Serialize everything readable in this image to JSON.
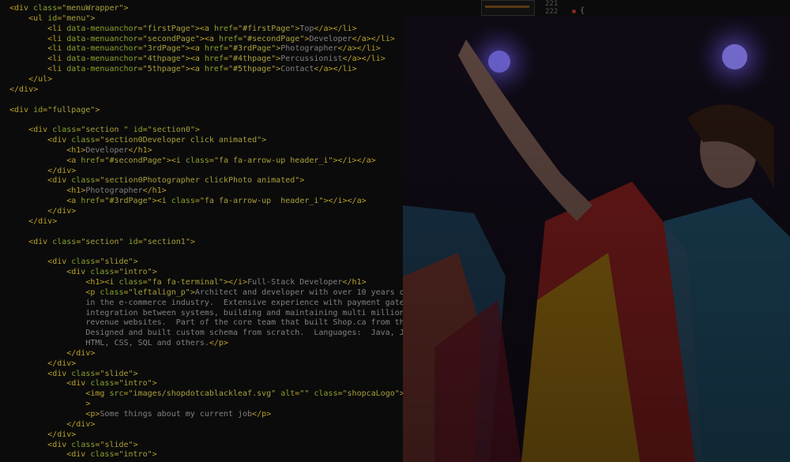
{
  "code_lines": [
    [
      [
        "t",
        "<div "
      ],
      [
        "a",
        "class"
      ],
      [
        "t",
        "="
      ],
      [
        "s",
        "\"menuWrapper\""
      ],
      [
        "t",
        ">"
      ]
    ],
    [
      [
        "x",
        "    "
      ],
      [
        "t",
        "<ul "
      ],
      [
        "a",
        "id"
      ],
      [
        "t",
        "="
      ],
      [
        "s",
        "\"menu\""
      ],
      [
        "t",
        ">"
      ]
    ],
    [
      [
        "x",
        "        "
      ],
      [
        "t",
        "<li "
      ],
      [
        "a",
        "data-menuanchor"
      ],
      [
        "t",
        "="
      ],
      [
        "s",
        "\"firstPage\""
      ],
      [
        "t",
        "><a "
      ],
      [
        "a",
        "href"
      ],
      [
        "t",
        "="
      ],
      [
        "s",
        "\"#firstPage\""
      ],
      [
        "t",
        ">"
      ],
      [
        "x",
        "Top"
      ],
      [
        "t",
        "</a></li>"
      ]
    ],
    [
      [
        "x",
        "        "
      ],
      [
        "t",
        "<li "
      ],
      [
        "a",
        "data-menuanchor"
      ],
      [
        "t",
        "="
      ],
      [
        "s",
        "\"secondPage\""
      ],
      [
        "t",
        "><a "
      ],
      [
        "a",
        "href"
      ],
      [
        "t",
        "="
      ],
      [
        "s",
        "\"#secondPage\""
      ],
      [
        "t",
        ">"
      ],
      [
        "x",
        "Developer"
      ],
      [
        "t",
        "</a></li>"
      ]
    ],
    [
      [
        "x",
        "        "
      ],
      [
        "t",
        "<li "
      ],
      [
        "a",
        "data-menuanchor"
      ],
      [
        "t",
        "="
      ],
      [
        "s",
        "\"3rdPage\""
      ],
      [
        "t",
        "><a "
      ],
      [
        "a",
        "href"
      ],
      [
        "t",
        "="
      ],
      [
        "s",
        "\"#3rdPage\""
      ],
      [
        "t",
        ">"
      ],
      [
        "x",
        "Photographer"
      ],
      [
        "t",
        "</a></li>"
      ]
    ],
    [
      [
        "x",
        "        "
      ],
      [
        "t",
        "<li "
      ],
      [
        "a",
        "data-menuanchor"
      ],
      [
        "t",
        "="
      ],
      [
        "s",
        "\"4thpage\""
      ],
      [
        "t",
        "><a "
      ],
      [
        "a",
        "href"
      ],
      [
        "t",
        "="
      ],
      [
        "s",
        "\"#4thpage\""
      ],
      [
        "t",
        ">"
      ],
      [
        "x",
        "Percussionist"
      ],
      [
        "t",
        "</a></li>"
      ]
    ],
    [
      [
        "x",
        "        "
      ],
      [
        "t",
        "<li "
      ],
      [
        "a",
        "data-menuanchor"
      ],
      [
        "t",
        "="
      ],
      [
        "s",
        "\"5thpage\""
      ],
      [
        "t",
        "><a "
      ],
      [
        "a",
        "href"
      ],
      [
        "t",
        "="
      ],
      [
        "s",
        "\"#5thpage\""
      ],
      [
        "t",
        ">"
      ],
      [
        "x",
        "Contact"
      ],
      [
        "t",
        "</a></li>"
      ]
    ],
    [
      [
        "x",
        "    "
      ],
      [
        "t",
        "</ul>"
      ]
    ],
    [
      [
        "t",
        "</div>"
      ]
    ],
    [],
    [
      [
        "t",
        "<div "
      ],
      [
        "a",
        "id"
      ],
      [
        "t",
        "="
      ],
      [
        "s",
        "\"fullpage\""
      ],
      [
        "t",
        ">"
      ]
    ],
    [],
    [
      [
        "x",
        "    "
      ],
      [
        "t",
        "<div "
      ],
      [
        "a",
        "class"
      ],
      [
        "t",
        "="
      ],
      [
        "s",
        "\"section \""
      ],
      [
        "x",
        " "
      ],
      [
        "a",
        "id"
      ],
      [
        "t",
        "="
      ],
      [
        "s",
        "\"section0\""
      ],
      [
        "t",
        ">"
      ]
    ],
    [
      [
        "x",
        "        "
      ],
      [
        "t",
        "<div "
      ],
      [
        "a",
        "class"
      ],
      [
        "t",
        "="
      ],
      [
        "s",
        "\"section0Developer click animated\""
      ],
      [
        "t",
        ">"
      ]
    ],
    [
      [
        "x",
        "            "
      ],
      [
        "t",
        "<h1>"
      ],
      [
        "x",
        "Developer"
      ],
      [
        "t",
        "</h1>"
      ]
    ],
    [
      [
        "x",
        "            "
      ],
      [
        "t",
        "<a "
      ],
      [
        "a",
        "href"
      ],
      [
        "t",
        "="
      ],
      [
        "s",
        "\"#secondPage\""
      ],
      [
        "t",
        "><i "
      ],
      [
        "a",
        "class"
      ],
      [
        "t",
        "="
      ],
      [
        "s",
        "\"fa fa-arrow-up header_i\""
      ],
      [
        "t",
        "></i></a>"
      ]
    ],
    [
      [
        "x",
        "        "
      ],
      [
        "t",
        "</div>"
      ]
    ],
    [
      [
        "x",
        "        "
      ],
      [
        "t",
        "<div "
      ],
      [
        "a",
        "class"
      ],
      [
        "t",
        "="
      ],
      [
        "s",
        "\"section0Photographer clickPhoto animated\""
      ],
      [
        "t",
        ">"
      ]
    ],
    [
      [
        "x",
        "            "
      ],
      [
        "t",
        "<h1>"
      ],
      [
        "x",
        "Photographer"
      ],
      [
        "t",
        "</h1>"
      ]
    ],
    [
      [
        "x",
        "            "
      ],
      [
        "t",
        "<a "
      ],
      [
        "a",
        "href"
      ],
      [
        "t",
        "="
      ],
      [
        "s",
        "\"#3rdPage\""
      ],
      [
        "t",
        "><i "
      ],
      [
        "a",
        "class"
      ],
      [
        "t",
        "="
      ],
      [
        "s",
        "\"fa fa-arrow-up  header_i\""
      ],
      [
        "t",
        "></i></a>"
      ]
    ],
    [
      [
        "x",
        "        "
      ],
      [
        "t",
        "</div>"
      ]
    ],
    [
      [
        "x",
        "    "
      ],
      [
        "t",
        "</div>"
      ]
    ],
    [],
    [
      [
        "x",
        "    "
      ],
      [
        "t",
        "<div "
      ],
      [
        "a",
        "class"
      ],
      [
        "t",
        "="
      ],
      [
        "s",
        "\"section\""
      ],
      [
        "x",
        " "
      ],
      [
        "a",
        "id"
      ],
      [
        "t",
        "="
      ],
      [
        "s",
        "\"section1\""
      ],
      [
        "t",
        ">"
      ]
    ],
    [],
    [
      [
        "x",
        "        "
      ],
      [
        "t",
        "<div "
      ],
      [
        "a",
        "class"
      ],
      [
        "t",
        "="
      ],
      [
        "s",
        "\"slide\""
      ],
      [
        "t",
        ">"
      ]
    ],
    [
      [
        "x",
        "            "
      ],
      [
        "t",
        "<div "
      ],
      [
        "a",
        "class"
      ],
      [
        "t",
        "="
      ],
      [
        "s",
        "\"intro\""
      ],
      [
        "t",
        ">"
      ]
    ],
    [
      [
        "x",
        "                "
      ],
      [
        "t",
        "<h1><i "
      ],
      [
        "a",
        "class"
      ],
      [
        "t",
        "="
      ],
      [
        "s",
        "\"fa fa-terminal\""
      ],
      [
        "t",
        "></i>"
      ],
      [
        "x",
        "Full-Stack Developer"
      ],
      [
        "t",
        "</h1>"
      ]
    ],
    [
      [
        "x",
        "                "
      ],
      [
        "t",
        "<p "
      ],
      [
        "a",
        "class"
      ],
      [
        "t",
        "="
      ],
      [
        "s",
        "\"leftalign_p\""
      ],
      [
        "t",
        ">"
      ],
      [
        "x",
        "Architect and developer with over 10 years of"
      ]
    ],
    [
      [
        "x",
        "                in the e-commerce industry.  Extensive experience with payment gate"
      ]
    ],
    [
      [
        "x",
        "                integration between systems, building and maintaining multi million"
      ]
    ],
    [
      [
        "x",
        "                revenue websites.  Part of the core team that built Shop.ca from th"
      ]
    ],
    [
      [
        "x",
        "                Designed and built custom schema from scratch.  Languages:  Java, J"
      ]
    ],
    [
      [
        "x",
        "                HTML, CSS, SQL and others."
      ],
      [
        "t",
        "</p>"
      ]
    ],
    [
      [
        "x",
        "            "
      ],
      [
        "t",
        "</div>"
      ]
    ],
    [
      [
        "x",
        "        "
      ],
      [
        "t",
        "</div>"
      ]
    ],
    [
      [
        "x",
        "        "
      ],
      [
        "t",
        "<div "
      ],
      [
        "a",
        "class"
      ],
      [
        "t",
        "="
      ],
      [
        "s",
        "\"slide\""
      ],
      [
        "t",
        ">"
      ]
    ],
    [
      [
        "x",
        "            "
      ],
      [
        "t",
        "<div "
      ],
      [
        "a",
        "class"
      ],
      [
        "t",
        "="
      ],
      [
        "s",
        "\"intro\""
      ],
      [
        "t",
        ">"
      ]
    ],
    [
      [
        "x",
        "                "
      ],
      [
        "t",
        "<img "
      ],
      [
        "a",
        "src"
      ],
      [
        "t",
        "="
      ],
      [
        "s",
        "\"images/shopdotcablackleaf.svg\""
      ],
      [
        "x",
        " "
      ],
      [
        "a",
        "alt"
      ],
      [
        "t",
        "="
      ],
      [
        "s",
        "\"\""
      ],
      [
        "x",
        " "
      ],
      [
        "a",
        "class"
      ],
      [
        "t",
        "="
      ],
      [
        "s",
        "\"shopcaLogo\""
      ],
      [
        "t",
        ">"
      ]
    ],
    [
      [
        "x",
        "                "
      ],
      [
        "t",
        ">"
      ]
    ],
    [
      [
        "x",
        "                "
      ],
      [
        "t",
        "<p>"
      ],
      [
        "x",
        "Some things about my current job"
      ],
      [
        "t",
        "</p>"
      ]
    ],
    [
      [
        "x",
        "            "
      ],
      [
        "t",
        "</div>"
      ]
    ],
    [
      [
        "x",
        "        "
      ],
      [
        "t",
        "</div>"
      ]
    ],
    [
      [
        "x",
        "        "
      ],
      [
        "t",
        "<div "
      ],
      [
        "a",
        "class"
      ],
      [
        "t",
        "="
      ],
      [
        "s",
        "\"slide\""
      ],
      [
        "t",
        ">"
      ]
    ],
    [
      [
        "x",
        "            "
      ],
      [
        "t",
        "<div "
      ],
      [
        "a",
        "class"
      ],
      [
        "t",
        "="
      ],
      [
        "s",
        "\"intro\""
      ],
      [
        "t",
        ">"
      ]
    ]
  ],
  "editor_gutter": {
    "line_a": "221",
    "line_b": "222",
    "brace": "{"
  },
  "photo": {
    "colors": {
      "backdrop": "#120c18",
      "light": "#5a4cc8",
      "red_fabric": "#7a1c1c",
      "yellow_fabric": "#8a6a10",
      "teal_fabric": "#1f4c66",
      "skin": "#6a5048"
    }
  }
}
